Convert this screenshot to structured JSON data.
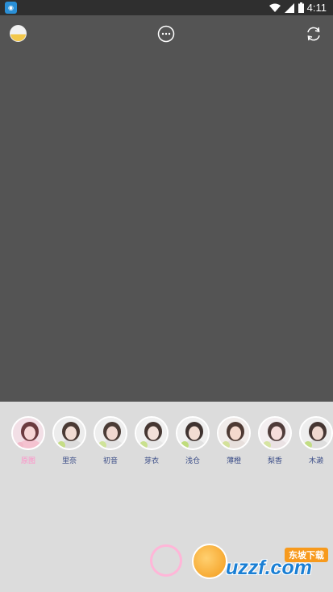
{
  "status_bar": {
    "time": "4:11",
    "app_icon": "camera-app-icon",
    "icons": [
      "wifi-icon",
      "signal-icon",
      "battery-icon"
    ]
  },
  "top_controls": {
    "gallery_thumbnail_icon": "gallery-thumbnail-icon",
    "more_icon": "more-dots-icon",
    "switch_camera_icon": "switch-camera-icon"
  },
  "filters": [
    {
      "label": "原图",
      "selected": true
    },
    {
      "label": "里奈",
      "selected": false
    },
    {
      "label": "初音",
      "selected": false
    },
    {
      "label": "芽衣",
      "selected": false
    },
    {
      "label": "浅仓",
      "selected": false
    },
    {
      "label": "薄橙",
      "selected": false
    },
    {
      "label": "梨香",
      "selected": false
    },
    {
      "label": "木濑",
      "selected": false
    }
  ],
  "shutter": {
    "icon": "shutter-ring-icon"
  },
  "watermark": {
    "tag": "东坡下载",
    "logo": "uzzf.com"
  },
  "colors": {
    "accent_pink": "#ff8fc8",
    "label_blue": "#3a4c87",
    "viewfinder": "#545454",
    "panel": "#dcdcdc"
  }
}
